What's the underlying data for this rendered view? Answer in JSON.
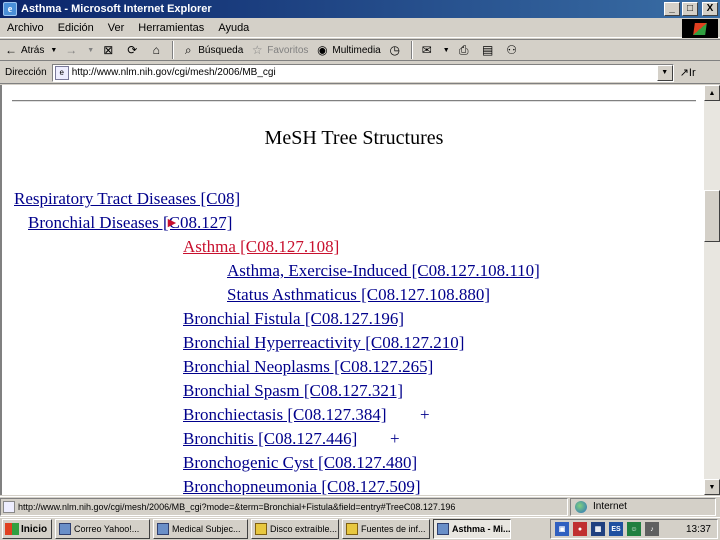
{
  "window": {
    "title": "Asthma - Microsoft Internet Explorer",
    "minimize": "_",
    "maximize": "□",
    "close": "X"
  },
  "menu": [
    "Archivo",
    "Edición",
    "Ver",
    "Herramientas",
    "Ayuda"
  ],
  "toolbar": {
    "back_label": "Atrás",
    "search_label": "Búsqueda",
    "favorites_label": "Favoritos",
    "multimedia_label": "Multimedia"
  },
  "address": {
    "label": "Dirección",
    "url": "http://www.nlm.nih.gov/cgi/mesh/2006/MB_cgi",
    "go_label": "Ir"
  },
  "page": {
    "title": "MeSH Tree Structures",
    "marker": "►",
    "tree": [
      {
        "label": "Respiratory Tract Diseases [C08]",
        "current": false
      },
      {
        "label": "Bronchial Diseases [C08.127]",
        "current": false
      },
      {
        "label": "Asthma [C08.127.108]",
        "current": true
      },
      {
        "label": "Asthma, Exercise-Induced [C08.127.108.110]",
        "current": false
      },
      {
        "label": "Status Asthmaticus [C08.127.108.880]",
        "current": false
      },
      {
        "label": "Bronchial Fistula [C08.127.196]",
        "current": false
      },
      {
        "label": "Bronchial Hyperreactivity [C08.127.210]",
        "current": false
      },
      {
        "label": "Bronchial Neoplasms [C08.127.265]",
        "current": false
      },
      {
        "label": "Bronchial Spasm [C08.127.321]",
        "current": false
      },
      {
        "label": "Bronchiectasis [C08.127.384]",
        "current": false,
        "suffix": "+"
      },
      {
        "label": "Bronchitis [C08.127.446]",
        "current": false,
        "suffix": "+"
      },
      {
        "label": "Bronchogenic Cyst [C08.127.480]",
        "current": false
      },
      {
        "label": "Bronchopneumonia [C08.127.509]",
        "current": false
      }
    ]
  },
  "status": {
    "text": "http://www.nlm.nih.gov/cgi/mesh/2006/MB_cgi?mode=&term=Bronchial+Fistula&field=entry#TreeC08.127.196",
    "zone": "Internet"
  },
  "taskbar": {
    "start": "Inicio",
    "tasks": [
      {
        "label": "Correo Yahoo!...",
        "active": false
      },
      {
        "label": "Medical Subjec...",
        "active": false
      },
      {
        "label": "Disco extraíble...",
        "active": false
      },
      {
        "label": "Fuentes de inf...",
        "active": false
      },
      {
        "label": "Asthma - Mi...",
        "active": true
      }
    ],
    "lang": "ES",
    "clock": "13:37"
  },
  "colors": {
    "link": "#00008b",
    "current": "#c8102e",
    "titlebar": "#0a246a"
  }
}
